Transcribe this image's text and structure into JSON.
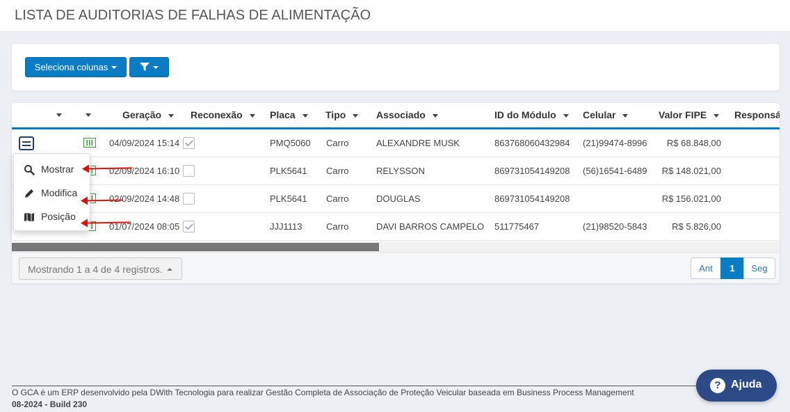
{
  "page": {
    "title": "LISTA DE AUDITORIAS DE FALHAS DE ALIMENTAÇÃO"
  },
  "toolbar": {
    "columns_label": "Seleciona colunas",
    "filter_icon": "filter-icon"
  },
  "table": {
    "headers": [
      "Geração",
      "Reconexão",
      "Placa",
      "Tipo",
      "Associado",
      "ID do Módulo",
      "Celular",
      "Valor FIPE",
      "Responsáv"
    ],
    "rows": [
      {
        "geracao": "04/09/2024 15:14",
        "reconexao": true,
        "placa": "PMQ5060",
        "tipo": "Carro",
        "associado": "ALEXANDRE MUSK",
        "modulo": "863768060432984",
        "celular": "(21)99474-8996",
        "fipe": "R$ 68.848,00"
      },
      {
        "geracao": "02/09/2024 16:10",
        "reconexao": false,
        "placa": "PLK5641",
        "tipo": "Carro",
        "associado": "RELYSSON",
        "modulo": "869731054149208",
        "celular": "(56)16541-6489",
        "fipe": "R$ 148.021,00"
      },
      {
        "geracao": "02/09/2024 14:48",
        "reconexao": false,
        "placa": "PLK5641",
        "tipo": "Carro",
        "associado": "DOUGLAS",
        "modulo": "869731054149208",
        "celular": "",
        "fipe": "R$ 156.021,00"
      },
      {
        "geracao": "01/07/2024 08:05",
        "reconexao": true,
        "placa": "JJJ1113",
        "tipo": "Carro",
        "associado": "DAVI BARROS CAMPELO",
        "modulo": "511775467",
        "celular": "(21)98520-5843",
        "fipe": "R$ 5.826,00"
      }
    ]
  },
  "dropdown": {
    "items": [
      {
        "label": "Mostrar",
        "icon": "search-icon"
      },
      {
        "label": "Modifica",
        "icon": "pencil-icon"
      },
      {
        "label": "Posição",
        "icon": "map-icon"
      }
    ]
  },
  "pagination": {
    "summary": "Mostrando 1 a 4 de 4 registros.",
    "prev": "Ant",
    "current": "1",
    "next": "Seg"
  },
  "footer": {
    "line1": "O GCA é um ERP desenvolvido pela DWith Tecnologia para realizar Gestão Completa de Associação de Proteção Veicular baseada em Business Process Management",
    "line2": "08-2024 - Build 230"
  },
  "help": {
    "label": "Ajuda"
  },
  "colors": {
    "primary": "#0a7cc4",
    "help": "#2c4a86",
    "annotation_arrow": "#e01010"
  }
}
